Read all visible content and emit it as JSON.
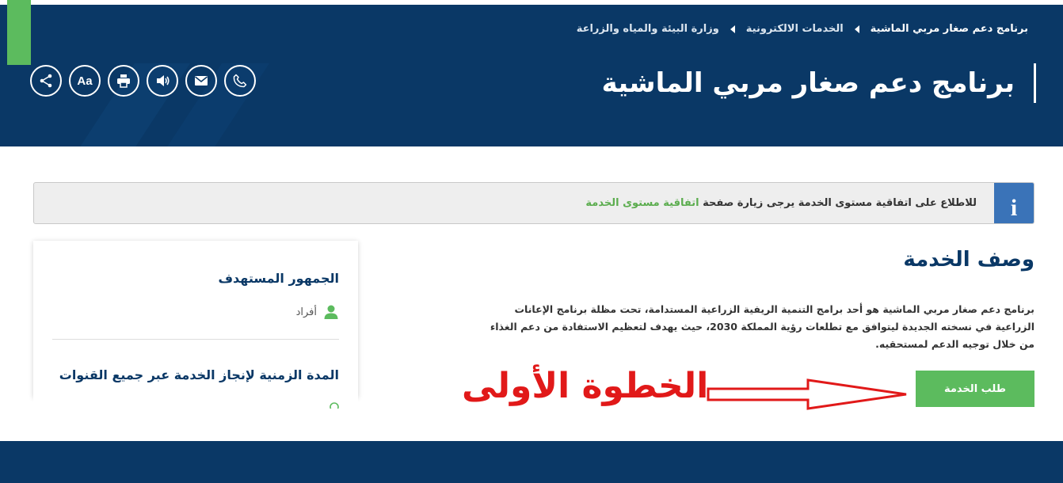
{
  "breadcrumb": {
    "items": [
      {
        "label": "وزارة البيئة والمياه والزراعة"
      },
      {
        "label": "الخدمات الالكترونية"
      },
      {
        "label": "برنامج دعم صغار مربي الماشية"
      }
    ]
  },
  "header": {
    "title": "برنامج دعم صغار مربي الماشية",
    "tools": [
      {
        "icon": "share-icon"
      },
      {
        "icon": "font-size-icon",
        "label": "Aa"
      },
      {
        "icon": "print-icon"
      },
      {
        "icon": "speaker-icon"
      },
      {
        "icon": "mail-icon"
      },
      {
        "icon": "phone-icon"
      }
    ]
  },
  "notice": {
    "icon_label": "i",
    "text": "للاطلاع على اتفاقية مستوى الخدمة يرجى زيارة صفحة",
    "link": "اتفاقية مستوى الخدمة"
  },
  "sidebar": {
    "audience_heading": "الجمهور المستهدف",
    "audience_value": "أفراد",
    "duration_heading": "المدة الزمنية لإنجاز الخدمة عبر جميع القنوات"
  },
  "main": {
    "section_title": "وصف الخدمة",
    "description": "برنامج دعم صغار مربي الماشية هو أحد برامج التنمية الريفية الزراعية المستدامة، تحت مظلة برنامج الإعانات الزراعية في نسخته الجديدة ليتوافق مع تطلعات رؤية المملكة 2030، حيث يهدف لتعظيم الاستفادة من دعم الغذاء من خلال توجيه الدعم لمستحقيه.",
    "request_button": "طلب الخدمة"
  },
  "annotation": {
    "text": "الخطوة الأولى"
  },
  "colors": {
    "navy": "#0a3866",
    "green": "#5cbb5e",
    "info_blue": "#3a73b8",
    "annotation_red": "#e11919"
  }
}
